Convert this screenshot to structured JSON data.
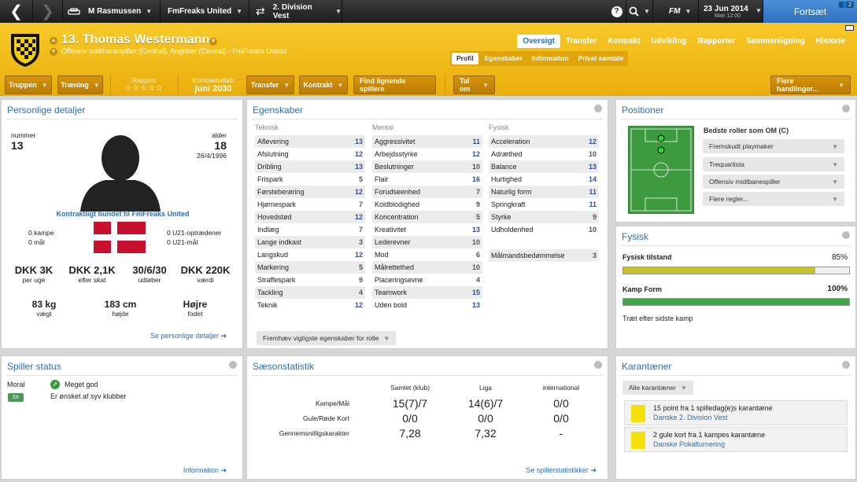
{
  "topbar": {
    "manager": "M Rasmussen",
    "club": "FmFreaks United",
    "division": "2. Division Vest",
    "fm_label": "FM",
    "date": "23 Jun 2014",
    "date_sub": "Man 12:00",
    "continue_label": "Fortsæt",
    "badge": "2"
  },
  "header": {
    "name": "13. Thomas Westermann",
    "description": "Offensiv midtbanespiller (Central), Angriber (Central) - FmFreaks United",
    "tabs": [
      "Oversigt",
      "Transfer",
      "Kontrakt",
      "Udvikling",
      "Rapporter",
      "Sammenligning",
      "Historie"
    ],
    "subtabs": [
      "Profil",
      "Egenskaber",
      "Information",
      "Privat samtale"
    ],
    "buttons": {
      "squad": "Truppen",
      "training": "Træning",
      "transfer": "Transfer",
      "contract": "Kontrakt",
      "find_similar": "Find lignende spillere",
      "talk": "Tal om",
      "more": "Flere handlinger..."
    },
    "report_label": "Rapport",
    "report_stars": "☆☆☆☆☆",
    "contract_label": "Kontraktudløb",
    "contract_value": "juni 2030"
  },
  "personal": {
    "title": "Personlige detaljer",
    "number_label": "nummer",
    "number": "13",
    "age_label": "alder",
    "age": "18",
    "dob": "26/4/1996",
    "contract_text": "Kontraktligt bundet til FmFreaks United",
    "matches": "0 kampe",
    "goals": "0 mål",
    "u21_apps": "0 U21-optrædener",
    "u21_goals": "0 U21-mål",
    "wage": "DKK 3K",
    "wage_label": "per uge",
    "wage_net": "DKK 2,1K",
    "wage_net_label": "efter skat",
    "expiry": "30/6/30",
    "expiry_label": "udløber",
    "value": "DKK 220K",
    "value_label": "værdi",
    "weight": "83 kg",
    "weight_label": "vægt",
    "height": "183 cm",
    "height_label": "højde",
    "foot": "Højre",
    "foot_label": "fodet",
    "link": "Se personlige detaljer",
    "flag_colors": {
      "red": "#c8102e",
      "white": "#ffffff"
    }
  },
  "attributes": {
    "title": "Egenskaber",
    "technical_header": "Teknisk",
    "mental_header": "Mental",
    "physical_header": "Fysisk",
    "technical": [
      {
        "name": "Aflevering",
        "value": "13"
      },
      {
        "name": "Afslutning",
        "value": "12"
      },
      {
        "name": "Dribling",
        "value": "13"
      },
      {
        "name": "Frispark",
        "value": "5"
      },
      {
        "name": "Førsteberøring",
        "value": "12"
      },
      {
        "name": "Hjørnespark",
        "value": "7"
      },
      {
        "name": "Hovedstød",
        "value": "12"
      },
      {
        "name": "Indlæg",
        "value": "7"
      },
      {
        "name": "Lange indkast",
        "value": "3"
      },
      {
        "name": "Langskud",
        "value": "12"
      },
      {
        "name": "Markering",
        "value": "5"
      },
      {
        "name": "Straffespark",
        "value": "9"
      },
      {
        "name": "Tackling",
        "value": "4"
      },
      {
        "name": "Teknik",
        "value": "12"
      }
    ],
    "mental": [
      {
        "name": "Aggressivitet",
        "value": "11"
      },
      {
        "name": "Arbejdsstyrke",
        "value": "12"
      },
      {
        "name": "Beslutninger",
        "value": "10"
      },
      {
        "name": "Flair",
        "value": "16"
      },
      {
        "name": "Forudseenhed",
        "value": "7"
      },
      {
        "name": "Koldblodighed",
        "value": "9"
      },
      {
        "name": "Koncentration",
        "value": "5"
      },
      {
        "name": "Kreativitet",
        "value": "13"
      },
      {
        "name": "Lederevner",
        "value": "10"
      },
      {
        "name": "Mod",
        "value": "6"
      },
      {
        "name": "Målrettethed",
        "value": "10"
      },
      {
        "name": "Placeringsevne",
        "value": "4"
      },
      {
        "name": "Teamwork",
        "value": "15"
      },
      {
        "name": "Uden bold",
        "value": "13"
      }
    ],
    "physical": [
      {
        "name": "Acceleration",
        "value": "12"
      },
      {
        "name": "Adræthed",
        "value": "10"
      },
      {
        "name": "Balance",
        "value": "13"
      },
      {
        "name": "Hurtighed",
        "value": "14"
      },
      {
        "name": "Naturlig form",
        "value": "11"
      },
      {
        "name": "Springkraft",
        "value": "11"
      },
      {
        "name": "Styrke",
        "value": "9"
      },
      {
        "name": "Udholdenhed",
        "value": "10"
      }
    ],
    "goalkeeper": {
      "name": "Målmandsbedømmelse",
      "value": "3"
    },
    "highlight_button": "Fremhæv vigtigste egenskaber for rolle"
  },
  "positions": {
    "title": "Positioner",
    "best_roles_label": "Bedste roller som OM (C)",
    "roles": [
      "Fremskudt playmaker",
      "Trequartista",
      "Offensiv midtbanespiller",
      "Flere regler..."
    ],
    "pitch_color": "#3e9a3e"
  },
  "physical": {
    "title": "Fysisk",
    "condition_label": "Fysisk tilstand",
    "condition_value": "85%",
    "condition": 0.85,
    "form_label": "Kamp Form",
    "form_value": "100%",
    "form": 1.0,
    "note": "Træt efter sidste kamp"
  },
  "status": {
    "title": "Spiller status",
    "moral_label": "Moral",
    "moral_value": "Meget god",
    "tag": "Elt",
    "note": "Er ønsket af syv klubber",
    "link": "Information"
  },
  "season": {
    "title": "Sæsonstatistik",
    "columns": [
      "Samlet (klub)",
      "Liga",
      "international"
    ],
    "rows": [
      {
        "label": "Kampe/Mål",
        "values": [
          "15(7)/7",
          "14(6)/7",
          "0/0"
        ]
      },
      {
        "label": "Gule/Røde Kort",
        "values": [
          "0/0",
          "0/0",
          "0/0"
        ]
      },
      {
        "label": "Gennemsnitligskarakter",
        "values": [
          "7,28",
          "7,32",
          "-"
        ]
      }
    ],
    "link": "Se spillerstatistikker"
  },
  "suspensions": {
    "title": "Karantæner",
    "filter": "Alle karantæner",
    "items": [
      {
        "text": "15 point fra 1 spilledag(e)s karantæne",
        "competition": "Danske 2. Division Vest"
      },
      {
        "text": "2 gule kort fra 1 kampes karantæne",
        "competition": "Danske Pokalturnering"
      }
    ]
  }
}
